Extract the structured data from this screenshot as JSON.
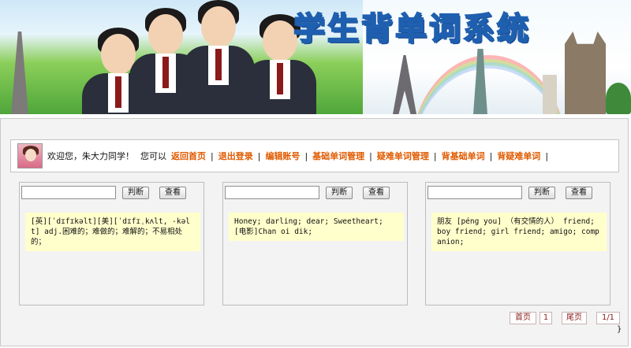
{
  "banner": {
    "title": "学生背单词系统"
  },
  "nav": {
    "greeting": "欢迎您，",
    "user_name": "朱大力",
    "user_suffix": " 同学！",
    "can_prompt": "您可以",
    "links": [
      "返回首页",
      "退出登录",
      "编辑账号",
      "基础单词管理",
      "疑难单词管理",
      "背基础单词",
      "背疑难单词"
    ],
    "separator": "|"
  },
  "cards": [
    {
      "input_value": "",
      "judge_label": "判断",
      "view_label": "查看",
      "note": "[英][ˈdɪfɪkəlt][美][ˈdɪfɪˌkʌlt, -kəlt] adj.困难的；难做的；难解的；不易相处的；"
    },
    {
      "input_value": "",
      "judge_label": "判断",
      "view_label": "查看",
      "note": "Honey; darling; dear; Sweetheart; [电影]Chan oi dik;"
    },
    {
      "input_value": "",
      "judge_label": "判断",
      "view_label": "查看",
      "note": "朋友 [péng you] （有交情的人） friend; boy friend; girl friend; amigo; companion;"
    }
  ],
  "pager": {
    "first": "首页",
    "page": "1",
    "last": "尾页",
    "count": "1/1"
  },
  "stray_char": "}",
  "colors": {
    "nav_link": "#e05a00",
    "note_bg": "#ffffcc",
    "pager_text": "#8a1a1a",
    "title_fill": "#fff3a0",
    "title_stroke": "#1f5fb0"
  }
}
